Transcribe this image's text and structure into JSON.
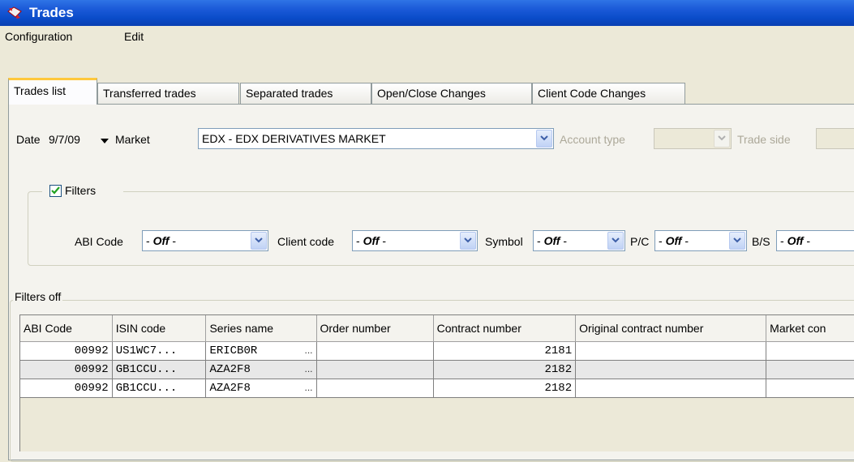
{
  "window": {
    "title": "Trades"
  },
  "menu": [
    "Configuration",
    "Edit"
  ],
  "tabs": [
    "Trades list",
    "Transferred trades",
    "Separated trades",
    "Open/Close Changes",
    "Client Code Changes"
  ],
  "toolbar": {
    "date_label": "Date",
    "date_value": "9/7/09",
    "market_label": "Market",
    "market_value": "EDX -  EDX DERIVATIVES MARKET",
    "account_type_label": "Account type",
    "trade_side_label": "Trade side"
  },
  "filters": {
    "checkbox_label": "Filters",
    "checked": true,
    "abi_label": "ABI Code",
    "client_label": "Client code",
    "symbol_label": "Symbol",
    "pc_label": "P/C",
    "bs_label": "B/S",
    "off_prefix": "- ",
    "off_word": "Off",
    "off_suffix": " -"
  },
  "results": {
    "group_label": "Filters off",
    "columns": [
      "ABI Code",
      "ISIN code",
      "Series name",
      "Order number",
      "Contract number",
      "Original contract number",
      "Market con"
    ],
    "rows": [
      {
        "abi": "00992",
        "isin": "US1WC7...",
        "series": "ERICB0R",
        "order": "",
        "contract": "2181",
        "orig": "",
        "market": ""
      },
      {
        "abi": "00992",
        "isin": "GB1CCU...",
        "series": "AZA2F8",
        "order": "",
        "contract": "2182",
        "orig": "",
        "market": ""
      },
      {
        "abi": "00992",
        "isin": "GB1CCU...",
        "series": "AZA2F8",
        "order": "",
        "contract": "2182",
        "orig": "",
        "market": ""
      }
    ],
    "ellipsis": "..."
  },
  "colors": {
    "titlebar": "#0a4cc9",
    "tab_accent": "#ffc83c",
    "check": "#21a121"
  }
}
